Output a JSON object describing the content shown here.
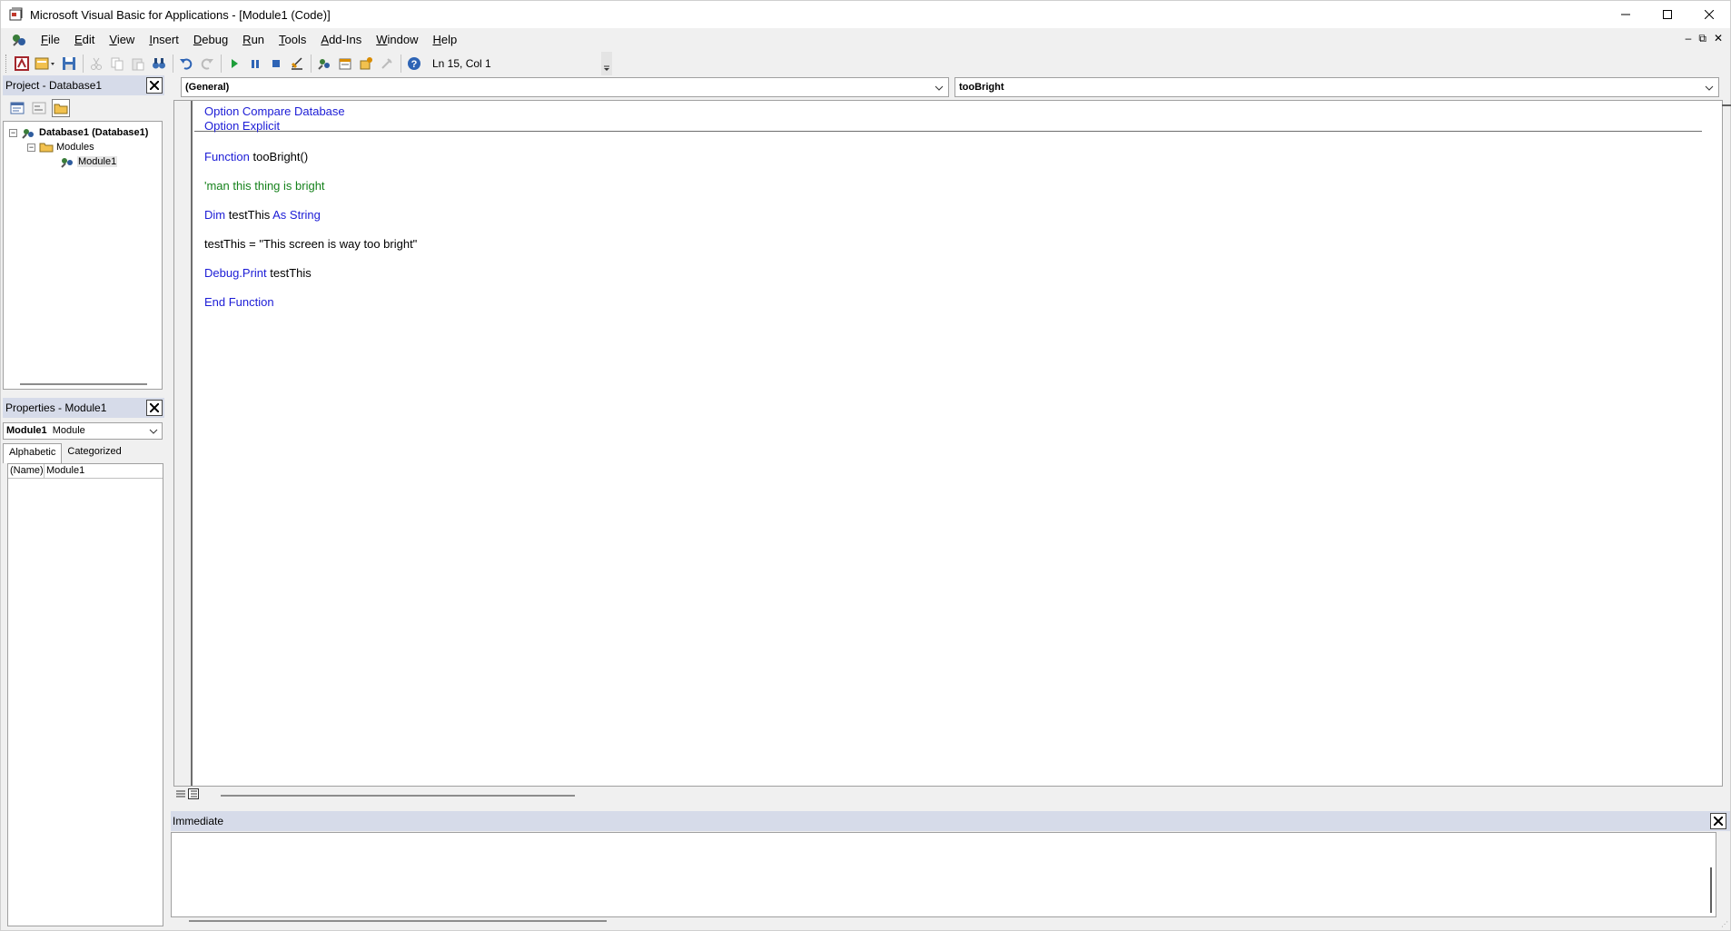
{
  "window": {
    "title": "Microsoft Visual Basic for Applications - [Module1 (Code)]"
  },
  "menu": {
    "items": [
      {
        "label": "File",
        "u": "F"
      },
      {
        "label": "Edit",
        "u": "E"
      },
      {
        "label": "View",
        "u": "V"
      },
      {
        "label": "Insert",
        "u": "I"
      },
      {
        "label": "Debug",
        "u": "D"
      },
      {
        "label": "Run",
        "u": "R"
      },
      {
        "label": "Tools",
        "u": "T"
      },
      {
        "label": "Add-Ins",
        "u": "A"
      },
      {
        "label": "Window",
        "u": "W"
      },
      {
        "label": "Help",
        "u": "H"
      }
    ]
  },
  "toolbar": {
    "position": "Ln 15, Col 1"
  },
  "project": {
    "title": "Project - Database1",
    "tree": {
      "root": "Database1 (Database1)",
      "folder": "Modules",
      "module": "Module1"
    }
  },
  "properties": {
    "title": "Properties - Module1",
    "object_name": "Module1",
    "object_type": "Module",
    "tabs": [
      "Alphabetic",
      "Categorized"
    ],
    "rows": [
      {
        "name": "(Name)",
        "value": "Module1"
      }
    ]
  },
  "code": {
    "object_combo": "(General)",
    "proc_combo": "tooBright",
    "lines": [
      [
        {
          "t": "Option Compare Database",
          "c": "kw"
        }
      ],
      [
        {
          "t": "Option Explicit",
          "c": "kw"
        }
      ],
      [],
      [
        {
          "t": "Function",
          "c": "kw"
        },
        {
          "t": " tooBright()",
          "c": "tx"
        }
      ],
      [],
      [
        {
          "t": "'man this thing is bright",
          "c": "cm"
        }
      ],
      [],
      [
        {
          "t": "Dim",
          "c": "kw"
        },
        {
          "t": " testThis ",
          "c": "tx"
        },
        {
          "t": "As String",
          "c": "kw"
        }
      ],
      [],
      [
        {
          "t": "testThis = \"This screen is way too bright\"",
          "c": "tx"
        }
      ],
      [],
      [
        {
          "t": "Debug.Print",
          "c": "kw"
        },
        {
          "t": " testThis",
          "c": "tx"
        }
      ],
      [],
      [
        {
          "t": "End Function",
          "c": "kw"
        }
      ]
    ]
  },
  "immediate": {
    "title": "Immediate"
  },
  "colors": {
    "keyword": "#1c1cd6",
    "comment": "#16821c",
    "pane_header": "#d6dbe9"
  }
}
